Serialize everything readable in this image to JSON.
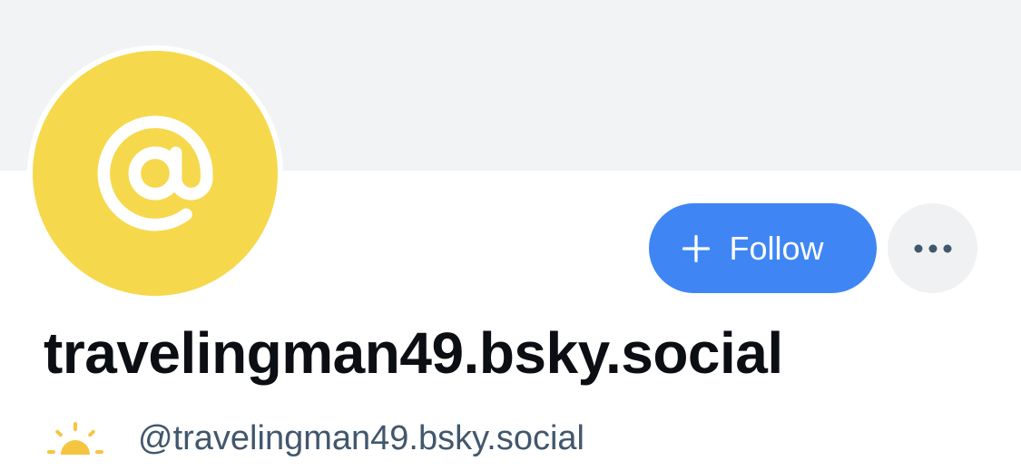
{
  "profile": {
    "display_name": "travelingman49.bsky.social",
    "handle": "@travelingman49.bsky.social",
    "follow_label": "Follow",
    "avatar_icon": "at-sign-icon",
    "handle_prefix_icon": "sunrise-icon",
    "more_icon": "more-options-icon"
  },
  "colors": {
    "banner": "#f1f3f5",
    "avatar": "#f6d84c",
    "follow_button": "#3f86f4",
    "more_button": "#eff1f3",
    "name_text": "#0b0f14",
    "handle_text": "#42576c"
  }
}
